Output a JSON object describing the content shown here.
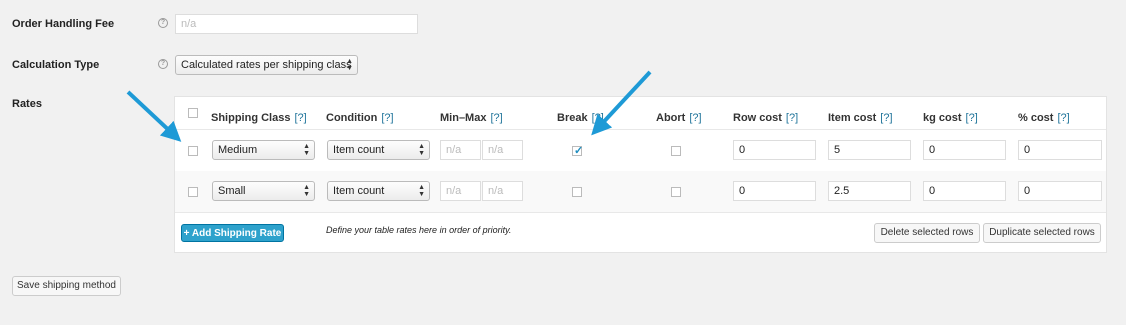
{
  "settings": {
    "handling_fee": {
      "label": "Order Handling Fee",
      "placeholder": "n/a",
      "value": ""
    },
    "calculation_type": {
      "label": "Calculation Type",
      "selected": "Calculated rates per shipping class"
    },
    "rates_label": "Rates"
  },
  "rates_table": {
    "columns": {
      "shipping_class": "Shipping Class",
      "condition": "Condition",
      "min_max": "Min–Max",
      "break": "Break",
      "abort": "Abort",
      "row_cost": "Row cost",
      "item_cost": "Item cost",
      "kg_cost": "kg cost",
      "pct_cost": "% cost",
      "help_link": "[?]"
    },
    "rows": [
      {
        "shipping_class": "Medium",
        "condition": "Item count",
        "min_placeholder": "n/a",
        "max_placeholder": "n/a",
        "break_checked": true,
        "abort_checked": false,
        "row_cost": "0",
        "item_cost": "5",
        "kg_cost": "0",
        "pct_cost": "0"
      },
      {
        "shipping_class": "Small",
        "condition": "Item count",
        "min_placeholder": "n/a",
        "max_placeholder": "n/a",
        "break_checked": false,
        "abort_checked": false,
        "row_cost": "0",
        "item_cost": "2.5",
        "kg_cost": "0",
        "pct_cost": "0"
      }
    ],
    "add_rate_label": "+ Add Shipping Rate",
    "hint": "Define your table rates here in order of priority.",
    "delete_label": "Delete selected rows",
    "duplicate_label": "Duplicate selected rows"
  },
  "save_label": "Save shipping method",
  "colors": {
    "accent": "#2ea2cc",
    "arrow": "#1e9ad6",
    "link": "#21759b"
  },
  "icons": {
    "help": "question-circle-icon",
    "select_arrows": "updown-arrows-icon",
    "check": "checkmark-icon"
  }
}
